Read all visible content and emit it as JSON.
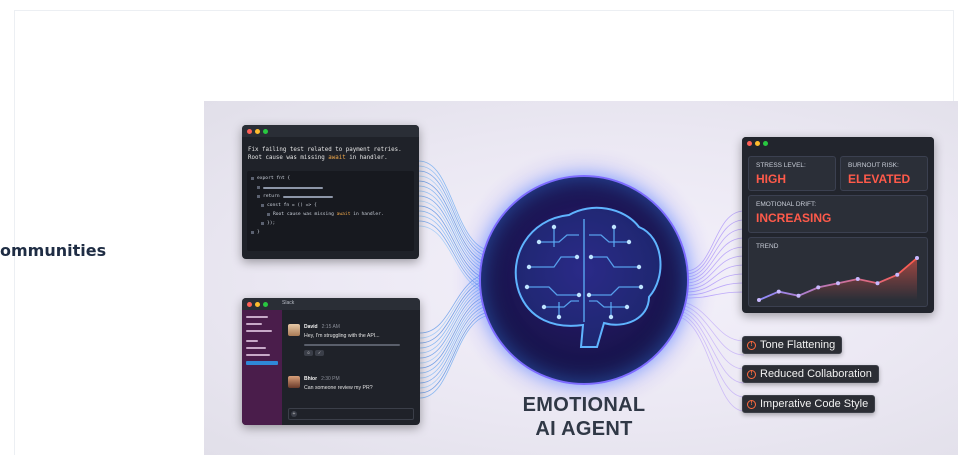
{
  "side_text": "ommunities",
  "illustration": {
    "code_window": {
      "message_line1": "Fix failing test related to payment retries.",
      "message_line2_before": "Root cause was missing ",
      "message_line2_highlight": "await",
      "message_line2_after": " in handler.",
      "code_line1": "export fnt {",
      "code_line2": "return",
      "code_line3": "const fn = () => {",
      "code_line4_before": "Root cause was missing ",
      "code_line4_highlight": "await",
      "code_line4_after": " in handler.",
      "code_line5": "});",
      "code_line6": "}"
    },
    "slack_window": {
      "title": "Slack",
      "messages": [
        {
          "name": "David",
          "time": "2:15 AM",
          "text": "Hey, I'm struggling with the API..."
        },
        {
          "name": "Bhior",
          "time": "2:30 PM",
          "text": "Can someone review my PR?"
        }
      ],
      "composer_plus": "+"
    },
    "agent_title_line1": "EMOTIONAL",
    "agent_title_line2": "AI AGENT",
    "dashboard": {
      "stress_label": "STRESS LEVEL:",
      "stress_value": "HIGH",
      "burnout_label": "BURNOUT RISK:",
      "burnout_value": "ELEVATED",
      "drift_label": "EMOTIONAL DRIFT:",
      "drift_value": "INCREASING",
      "trend_label": "TREND",
      "trend_values": [
        2,
        4,
        3,
        5,
        6,
        7,
        6,
        8,
        12
      ]
    },
    "badges": [
      {
        "icon": "!",
        "text": "Tone Flattening"
      },
      {
        "icon": "!",
        "text": "Reduced Collaboration"
      },
      {
        "icon": "!",
        "text": "Imperative Code Style"
      }
    ],
    "colors": {
      "alert": "#ff5a4a",
      "glow": "#7c6cff",
      "circuit": "#5fb4ff"
    }
  }
}
